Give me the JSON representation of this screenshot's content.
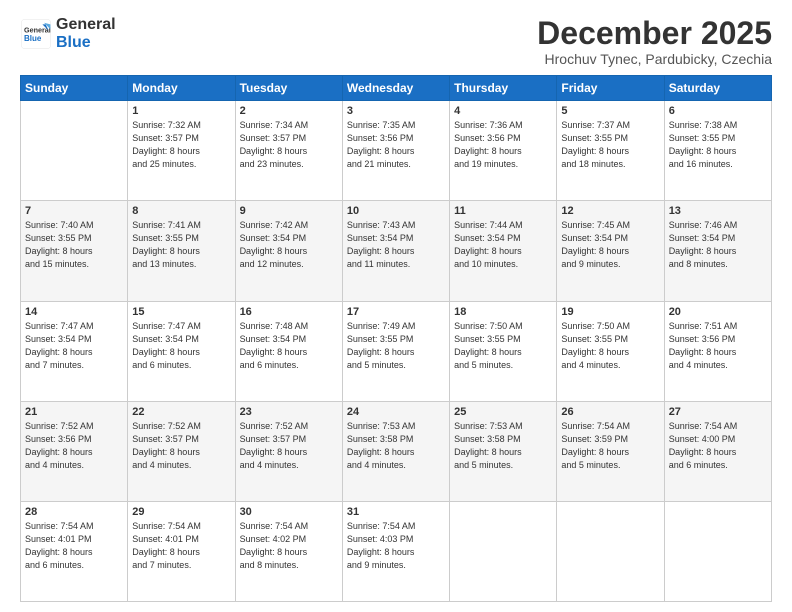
{
  "header": {
    "logo_line1": "General",
    "logo_line2": "Blue",
    "month": "December 2025",
    "location": "Hrochuv Tynec, Pardubicky, Czechia"
  },
  "weekdays": [
    "Sunday",
    "Monday",
    "Tuesday",
    "Wednesday",
    "Thursday",
    "Friday",
    "Saturday"
  ],
  "weeks": [
    [
      {
        "day": "",
        "info": ""
      },
      {
        "day": "1",
        "info": "Sunrise: 7:32 AM\nSunset: 3:57 PM\nDaylight: 8 hours\nand 25 minutes."
      },
      {
        "day": "2",
        "info": "Sunrise: 7:34 AM\nSunset: 3:57 PM\nDaylight: 8 hours\nand 23 minutes."
      },
      {
        "day": "3",
        "info": "Sunrise: 7:35 AM\nSunset: 3:56 PM\nDaylight: 8 hours\nand 21 minutes."
      },
      {
        "day": "4",
        "info": "Sunrise: 7:36 AM\nSunset: 3:56 PM\nDaylight: 8 hours\nand 19 minutes."
      },
      {
        "day": "5",
        "info": "Sunrise: 7:37 AM\nSunset: 3:55 PM\nDaylight: 8 hours\nand 18 minutes."
      },
      {
        "day": "6",
        "info": "Sunrise: 7:38 AM\nSunset: 3:55 PM\nDaylight: 8 hours\nand 16 minutes."
      }
    ],
    [
      {
        "day": "7",
        "info": "Sunrise: 7:40 AM\nSunset: 3:55 PM\nDaylight: 8 hours\nand 15 minutes."
      },
      {
        "day": "8",
        "info": "Sunrise: 7:41 AM\nSunset: 3:55 PM\nDaylight: 8 hours\nand 13 minutes."
      },
      {
        "day": "9",
        "info": "Sunrise: 7:42 AM\nSunset: 3:54 PM\nDaylight: 8 hours\nand 12 minutes."
      },
      {
        "day": "10",
        "info": "Sunrise: 7:43 AM\nSunset: 3:54 PM\nDaylight: 8 hours\nand 11 minutes."
      },
      {
        "day": "11",
        "info": "Sunrise: 7:44 AM\nSunset: 3:54 PM\nDaylight: 8 hours\nand 10 minutes."
      },
      {
        "day": "12",
        "info": "Sunrise: 7:45 AM\nSunset: 3:54 PM\nDaylight: 8 hours\nand 9 minutes."
      },
      {
        "day": "13",
        "info": "Sunrise: 7:46 AM\nSunset: 3:54 PM\nDaylight: 8 hours\nand 8 minutes."
      }
    ],
    [
      {
        "day": "14",
        "info": "Sunrise: 7:47 AM\nSunset: 3:54 PM\nDaylight: 8 hours\nand 7 minutes."
      },
      {
        "day": "15",
        "info": "Sunrise: 7:47 AM\nSunset: 3:54 PM\nDaylight: 8 hours\nand 6 minutes."
      },
      {
        "day": "16",
        "info": "Sunrise: 7:48 AM\nSunset: 3:54 PM\nDaylight: 8 hours\nand 6 minutes."
      },
      {
        "day": "17",
        "info": "Sunrise: 7:49 AM\nSunset: 3:55 PM\nDaylight: 8 hours\nand 5 minutes."
      },
      {
        "day": "18",
        "info": "Sunrise: 7:50 AM\nSunset: 3:55 PM\nDaylight: 8 hours\nand 5 minutes."
      },
      {
        "day": "19",
        "info": "Sunrise: 7:50 AM\nSunset: 3:55 PM\nDaylight: 8 hours\nand 4 minutes."
      },
      {
        "day": "20",
        "info": "Sunrise: 7:51 AM\nSunset: 3:56 PM\nDaylight: 8 hours\nand 4 minutes."
      }
    ],
    [
      {
        "day": "21",
        "info": "Sunrise: 7:52 AM\nSunset: 3:56 PM\nDaylight: 8 hours\nand 4 minutes."
      },
      {
        "day": "22",
        "info": "Sunrise: 7:52 AM\nSunset: 3:57 PM\nDaylight: 8 hours\nand 4 minutes."
      },
      {
        "day": "23",
        "info": "Sunrise: 7:52 AM\nSunset: 3:57 PM\nDaylight: 8 hours\nand 4 minutes."
      },
      {
        "day": "24",
        "info": "Sunrise: 7:53 AM\nSunset: 3:58 PM\nDaylight: 8 hours\nand 4 minutes."
      },
      {
        "day": "25",
        "info": "Sunrise: 7:53 AM\nSunset: 3:58 PM\nDaylight: 8 hours\nand 5 minutes."
      },
      {
        "day": "26",
        "info": "Sunrise: 7:54 AM\nSunset: 3:59 PM\nDaylight: 8 hours\nand 5 minutes."
      },
      {
        "day": "27",
        "info": "Sunrise: 7:54 AM\nSunset: 4:00 PM\nDaylight: 8 hours\nand 6 minutes."
      }
    ],
    [
      {
        "day": "28",
        "info": "Sunrise: 7:54 AM\nSunset: 4:01 PM\nDaylight: 8 hours\nand 6 minutes."
      },
      {
        "day": "29",
        "info": "Sunrise: 7:54 AM\nSunset: 4:01 PM\nDaylight: 8 hours\nand 7 minutes."
      },
      {
        "day": "30",
        "info": "Sunrise: 7:54 AM\nSunset: 4:02 PM\nDaylight: 8 hours\nand 8 minutes."
      },
      {
        "day": "31",
        "info": "Sunrise: 7:54 AM\nSunset: 4:03 PM\nDaylight: 8 hours\nand 9 minutes."
      },
      {
        "day": "",
        "info": ""
      },
      {
        "day": "",
        "info": ""
      },
      {
        "day": "",
        "info": ""
      }
    ]
  ]
}
